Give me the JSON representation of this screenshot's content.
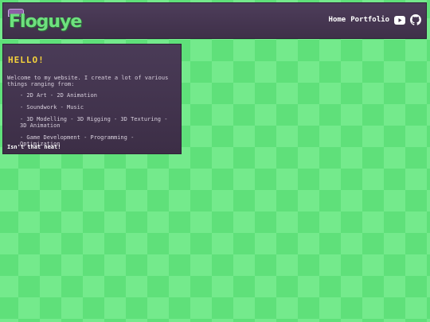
{
  "header": {
    "logo_text": "Floguye",
    "nav": {
      "home_label": "Home",
      "portfolio_label": "Portfolio"
    },
    "icons": [
      "youtube-icon",
      "github-icon"
    ]
  },
  "card": {
    "title": "HELLO!",
    "intro": "Welcome to my website. I create a lot of various things ranging from:",
    "skills": [
      "- 2D Art - 2D Animation",
      "- Soundwork - Music",
      "- 3D Modelling - 3D Rigging - 3D Texturing - 3D Animation",
      "- Game Development - Programming - Optimization"
    ],
    "outro": "Isn't that neat!"
  },
  "colors": {
    "header_bg": "#4d3d5a",
    "card_bg": "#4a3b57",
    "title": "#f5d23b",
    "check_light": "#74ea8c",
    "check_dark": "#5fe07a",
    "logo": "#6ee07e"
  }
}
